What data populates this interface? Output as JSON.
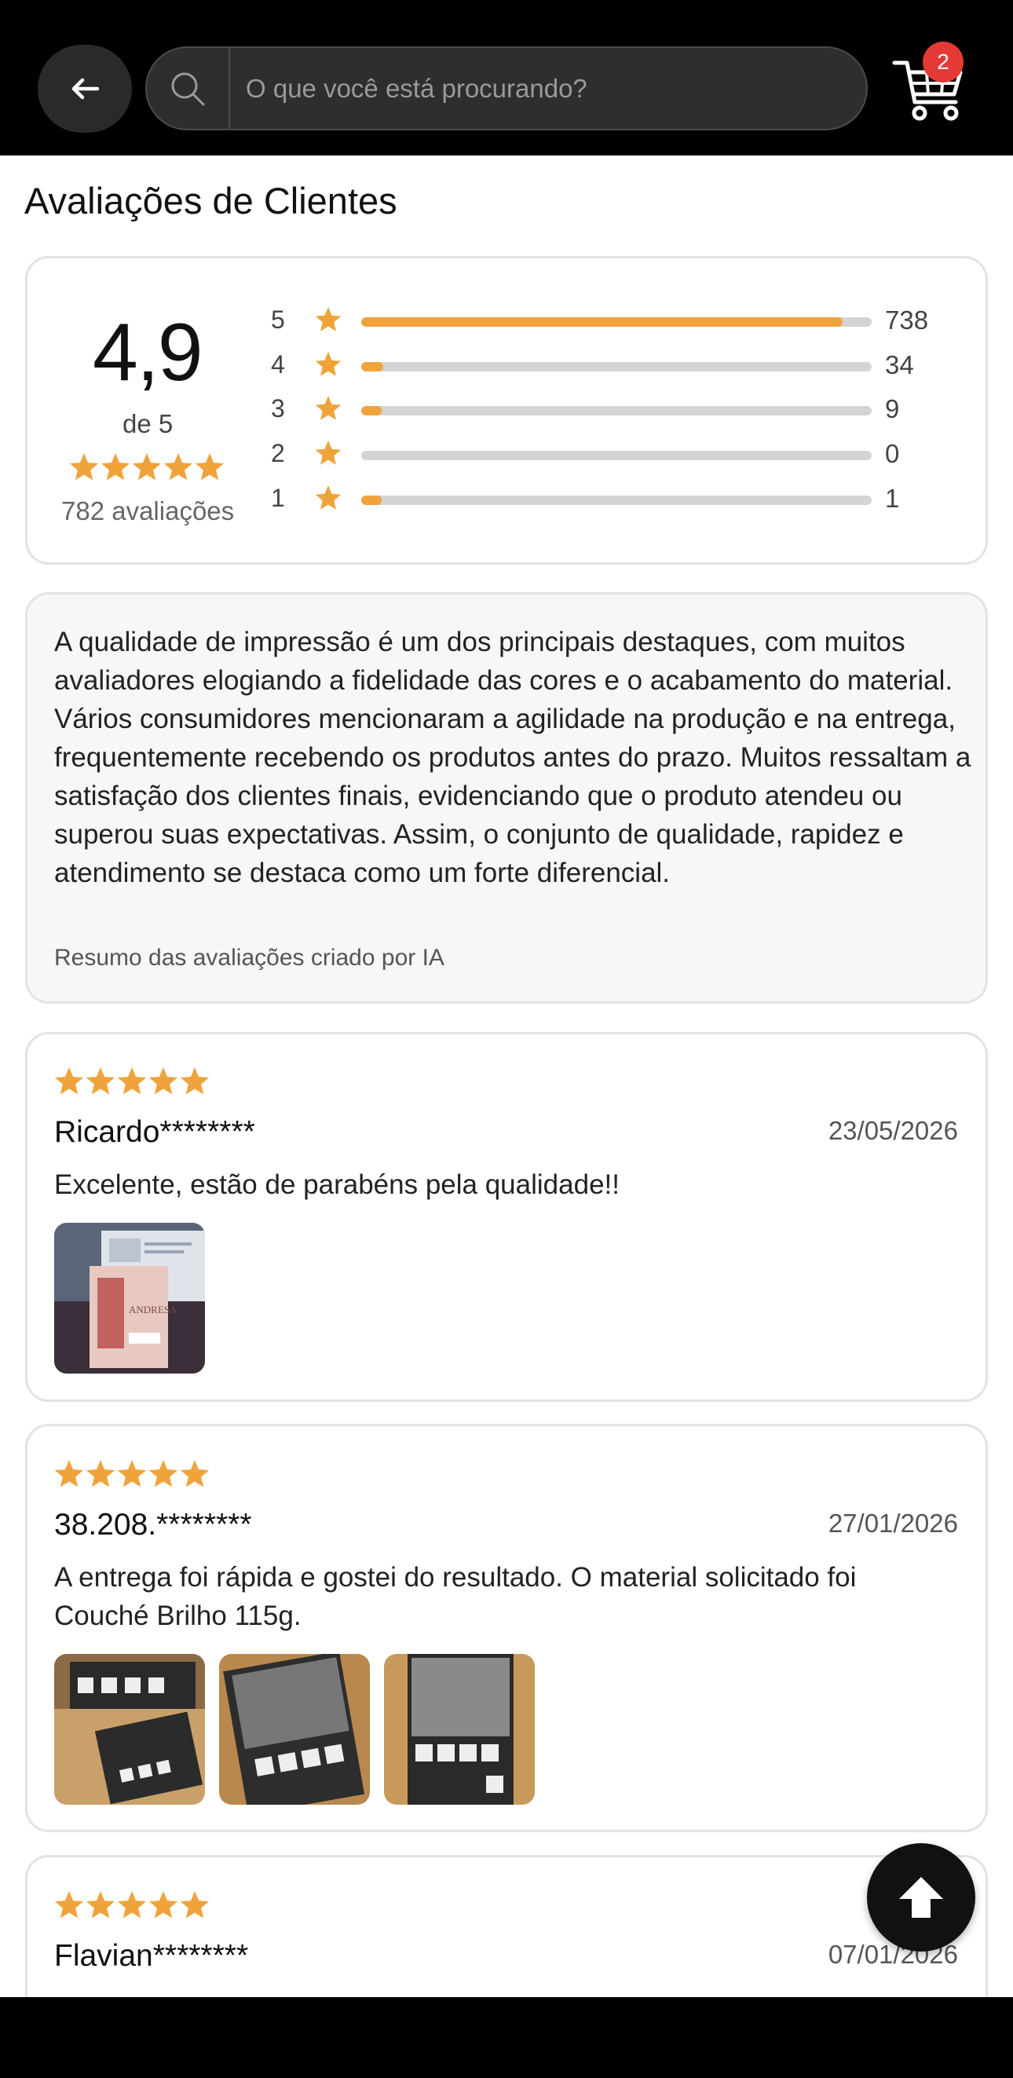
{
  "header": {
    "search_placeholder": "O que você está procurando?",
    "cart_count": "2",
    "icons": [
      "back-arrow-icon",
      "search-icon",
      "cart-icon"
    ]
  },
  "page": {
    "title": "Avaliações de Clientes"
  },
  "rating_summary": {
    "average": "4,9",
    "of_label": "de 5",
    "stars": 5,
    "total_label": "782 avaliações",
    "distribution": [
      {
        "stars": "5",
        "count": "738",
        "fraction": 0.9437
      },
      {
        "stars": "4",
        "count": "34",
        "fraction": 0.0435
      },
      {
        "stars": "3",
        "count": "9",
        "fraction": 0.0115
      },
      {
        "stars": "2",
        "count": "0",
        "fraction": 0
      },
      {
        "stars": "1",
        "count": "1",
        "fraction": 0.0013
      }
    ],
    "colors": {
      "star": "#f0a33b",
      "bar_fill": "#f0a33b",
      "bar_track": "#d4d4d4"
    }
  },
  "ai_summary": {
    "text": "A qualidade de impressão é um dos principais destaques, com muitos avaliadores elogiando a fidelidade das cores e o acabamento do material. Vários consumidores mencionaram a agilidade na produção e na entrega, frequentemente recebendo os produtos antes do prazo. Muitos ressaltam a satisfação dos clientes finais, evidenciando que o produto atendeu ou superou suas expectativas. Assim, o conjunto de qualidade, rapidez e atendimento se destaca como um forte diferencial.",
    "note": "Resumo das avaliações criado por IA"
  },
  "reviews": [
    {
      "rating": 5,
      "name": "Ricardo********",
      "date": "23/05/2026",
      "text": "Excelente, estão de parabéns pela qualidade!!",
      "photos": 1
    },
    {
      "rating": 5,
      "name": "38.208.********",
      "date": "27/01/2026",
      "text": "A entrega foi rápida e gostei do resultado. O material solicitado foi Couché Brilho 115g.",
      "photos": 3
    },
    {
      "rating": 5,
      "name": "Flavian********",
      "date": "07/01/2026",
      "text": "",
      "photos": 0
    }
  ],
  "scroll_top_icon": "arrow-up-icon"
}
